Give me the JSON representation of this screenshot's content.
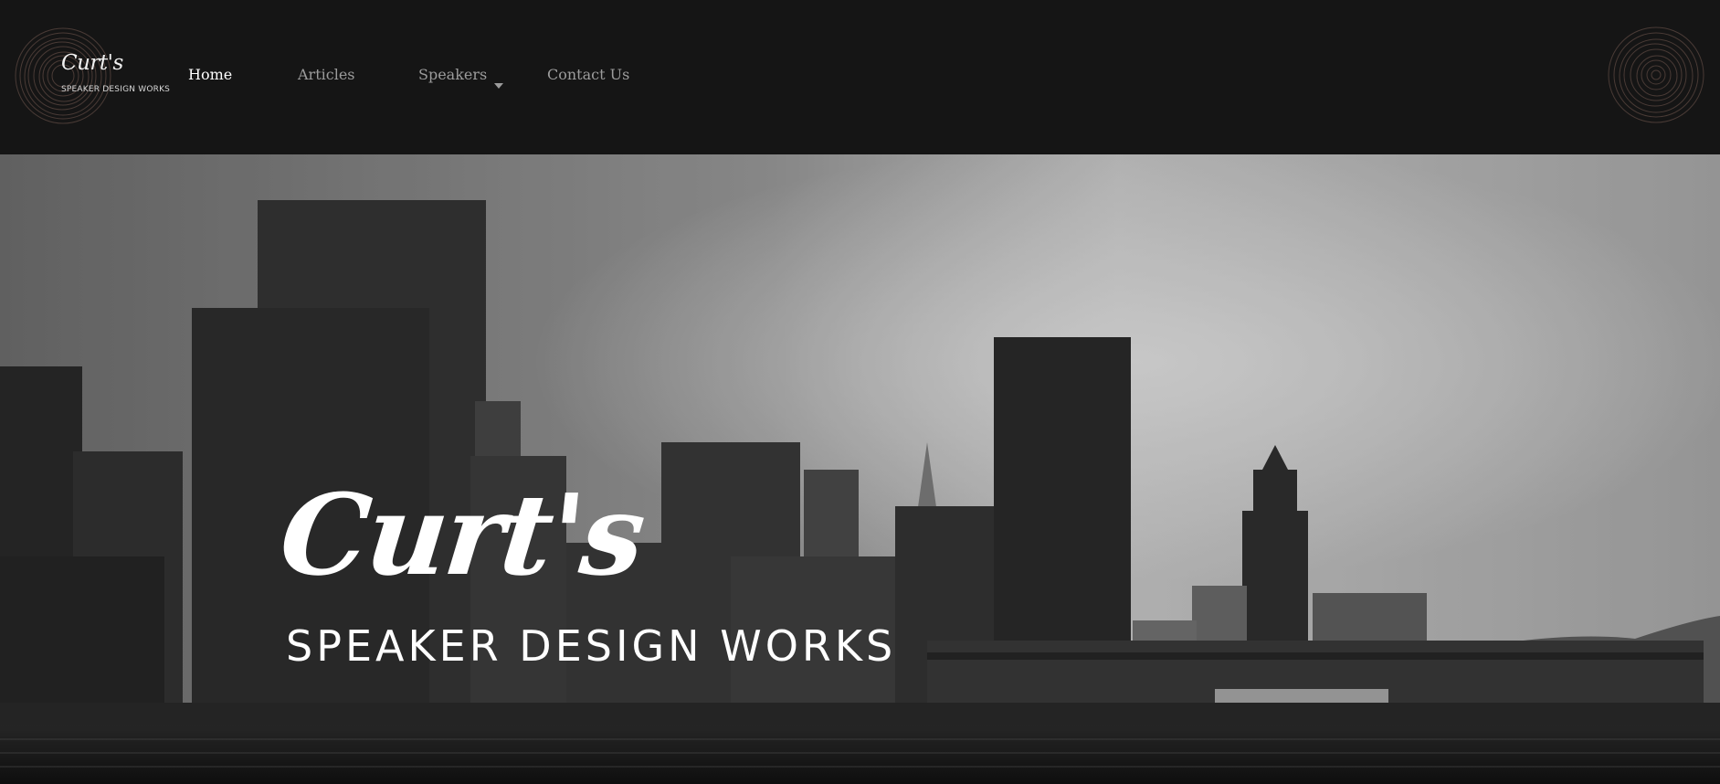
{
  "brand": {
    "logo_script": "Curt's",
    "logo_subtitle": "SPEAKER DESIGN WORKS"
  },
  "nav": {
    "items": [
      {
        "label": "Home",
        "active": true
      },
      {
        "label": "Articles",
        "active": false
      },
      {
        "label": "Speakers",
        "active": false,
        "has_dropdown": true
      },
      {
        "label": "Contact Us",
        "active": false
      }
    ]
  },
  "hero": {
    "title": "Curt's",
    "subtitle": "SPEAKER DESIGN WORKS"
  },
  "colors": {
    "header_bg": "#151515",
    "nav_active": "#ffffff",
    "nav_inactive": "#9c9c9c",
    "logo_rings": "#4a3b36"
  }
}
